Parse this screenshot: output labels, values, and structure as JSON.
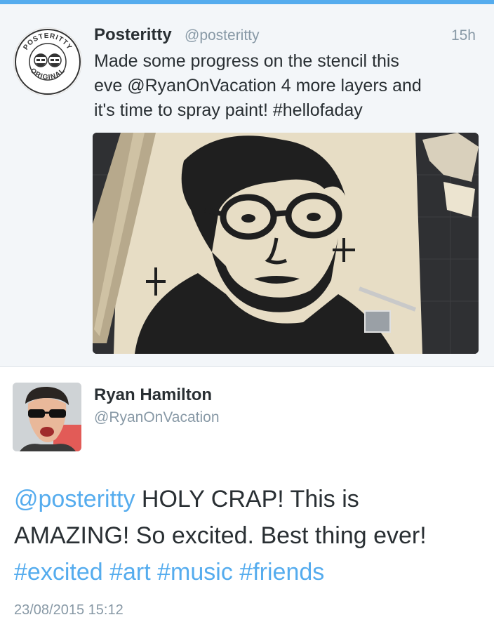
{
  "tweet1": {
    "author_name": "Posteritty",
    "handle": "@posteritty",
    "time": "15h",
    "lines": [
      "Made some progress on the stencil this",
      "eve @RyanOnVacation 4 more layers and",
      "it's time to spray paint! #hellofaday"
    ],
    "avatar_text": {
      "top": "POSTERITTY",
      "bottom": "ORIGINAL"
    },
    "media_icon": "stencil-portrait-photo"
  },
  "tweet2": {
    "author_name": "Ryan Hamilton",
    "handle": "@RyanOnVacation",
    "mention": "@posteritty",
    "text_line1": " HOLY CRAP! This is",
    "text_line2": "AMAZING! So excited. Best thing ever!",
    "hashtags": [
      "#excited",
      "#art",
      "#music",
      "#friends"
    ],
    "date": "23/08/2015 15:12",
    "avatar_icon": "profile-photo"
  },
  "colors": {
    "link": "#55acee",
    "secondary_text": "#8899a6",
    "primary_text": "#292f33",
    "highlight_bg": "#f3f6f9"
  }
}
